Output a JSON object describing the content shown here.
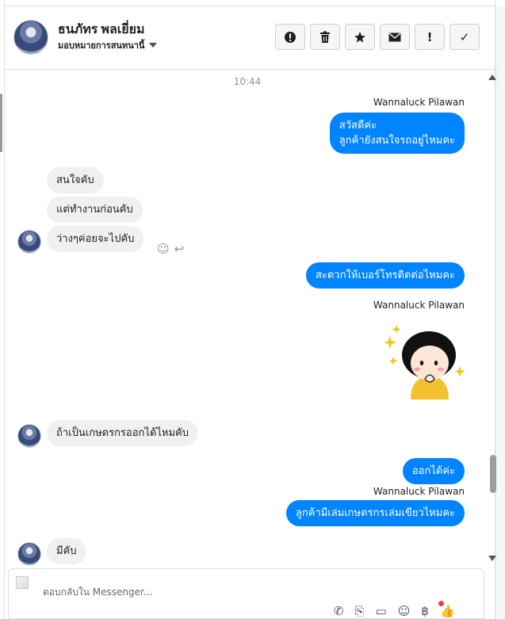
{
  "header": {
    "name": "ธนภัทร พลเยี่ยม",
    "status": "มอบหมายการสนทนานี้"
  },
  "toolbar": {
    "buttons": [
      {
        "name": "alert-icon",
        "glyph": "⬤"
      },
      {
        "name": "trash-icon",
        "glyph": "🗑"
      },
      {
        "name": "star-icon",
        "glyph": "★"
      },
      {
        "name": "envelope-icon",
        "glyph": "✉"
      },
      {
        "name": "exclamation-icon",
        "glyph": "!"
      },
      {
        "name": "check-icon",
        "glyph": "✓"
      }
    ]
  },
  "thread": {
    "timestamp": "10:44",
    "messages": [
      {
        "id": "m1",
        "from": "me",
        "sender": "Wannaluck Pilawan",
        "text": "สวัสดีค่ะ\nลูกค้ายังสนใจรถอยู่ไหมคะ"
      },
      {
        "id": "m2",
        "from": "them",
        "text": "สนใจคับ"
      },
      {
        "id": "m3",
        "from": "them",
        "text": "แต่ทำงานก่อนคับ"
      },
      {
        "id": "m4",
        "from": "them",
        "text": "ว่างๆค่อยจะไปคับ"
      },
      {
        "id": "m5",
        "from": "me",
        "text": "สะดวกให้เบอร์โทรติดต่อไหมคะ"
      },
      {
        "id": "m6",
        "from": "me",
        "sender": "Wannaluck Pilawan",
        "sticker": "girl-sticker"
      },
      {
        "id": "m7",
        "from": "them",
        "text": "ถ้าเป็นเกษตรกรออกได้ไหมคับ"
      },
      {
        "id": "m8",
        "from": "me",
        "text": "ออกได้ค่ะ"
      },
      {
        "id": "m9",
        "from": "me",
        "sender": "Wannaluck Pilawan",
        "text": "ลูกค้ามีเล่มเกษตรกรเล่มเขียวไหมคะ"
      },
      {
        "id": "m10",
        "from": "them",
        "text": "มีคับ"
      }
    ]
  },
  "composer": {
    "placeholder": "ตอบกลับใน Messenger...",
    "tools": [
      "phone-icon",
      "paperclip-icon",
      "saved-reply-icon",
      "emoji-icon",
      "baht-icon",
      "thumbs-up-icon"
    ]
  },
  "colors": {
    "outgoing": "#0084ff",
    "incoming": "#f1f0f0",
    "notification_dot": "#fa3e3e"
  }
}
